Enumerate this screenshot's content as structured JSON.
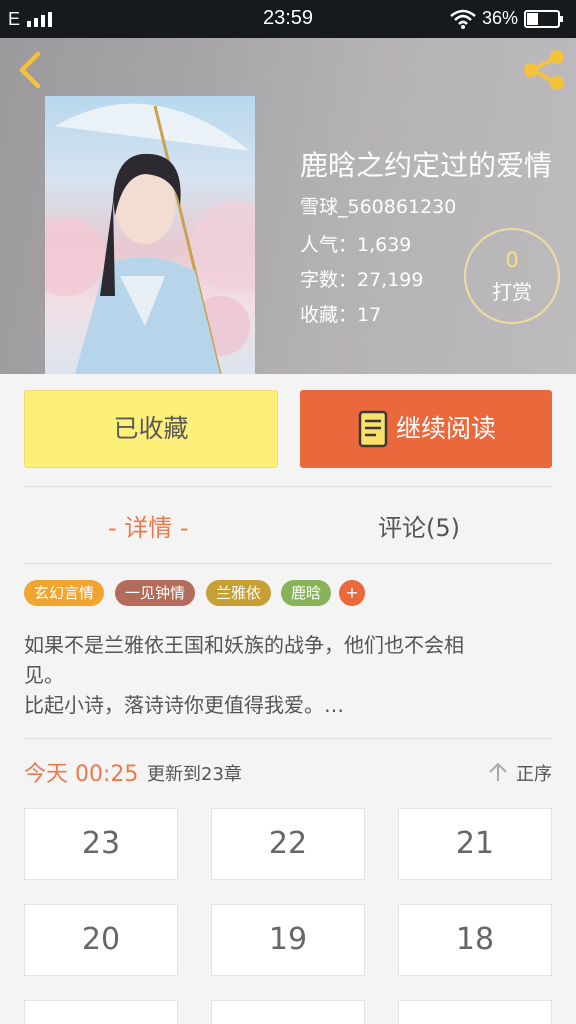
{
  "status_bar": {
    "carrier": "E",
    "time": "23:59",
    "battery": "36%"
  },
  "book": {
    "title": "鹿晗之约定过的爱情",
    "author": "雪球_560861230",
    "popularity": "人气：1,639",
    "word_count": "字数：27,199",
    "collections": "收藏：17"
  },
  "tip": {
    "count": "0",
    "label": "打赏"
  },
  "actions": {
    "collected_label": "已收藏",
    "continue_label": "继续阅读"
  },
  "tabs": {
    "details": "- 详情 -",
    "comments": "评论(5)"
  },
  "tags": [
    {
      "label": "玄幻言情",
      "color": "#f0a531"
    },
    {
      "label": "一见钟情",
      "color": "#b36b5b"
    },
    {
      "label": "兰雅依",
      "color": "#c6a035"
    },
    {
      "label": "鹿晗",
      "color": "#88b35a"
    }
  ],
  "tag_add": "+",
  "synopsis": {
    "line1": "如果不是兰雅依王国和妖族的战争，他们也不会相",
    "line2": "见。",
    "line3": "比起小诗，落诗诗你更值得我爱。…"
  },
  "update": {
    "time": "今天 00:25",
    "text": "更新到23章",
    "sort_label": "正序"
  },
  "chapters": [
    "23",
    "22",
    "21",
    "20",
    "19",
    "18"
  ],
  "colors": {
    "accent": "#ea683c",
    "collected_bg": "#fdf07a"
  }
}
